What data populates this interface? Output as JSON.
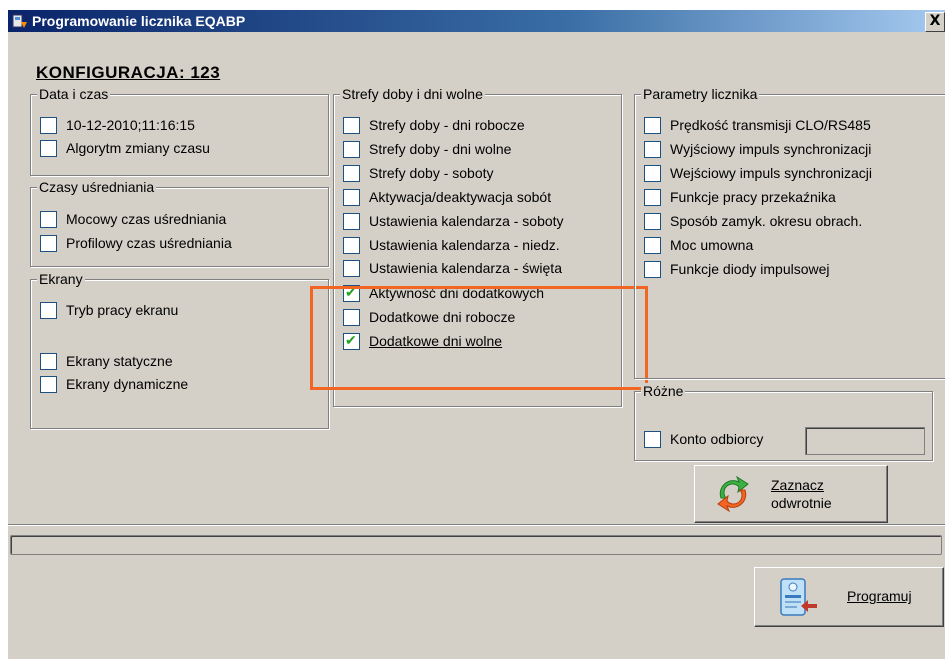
{
  "window": {
    "title": "Programowanie licznika EQABP",
    "close_label": "X"
  },
  "heading": "KONFIGURACJA:  123",
  "groups": {
    "data_czas": {
      "legend": "Data i czas",
      "items": [
        {
          "label": "10-12-2010;11:16:15",
          "checked": false
        },
        {
          "label": "Algorytm zmiany czasu",
          "checked": false
        }
      ]
    },
    "czasy": {
      "legend": "Czasy uśredniania",
      "items": [
        {
          "label": "Mocowy czas uśredniania",
          "checked": false
        },
        {
          "label": "Profilowy czas uśredniania",
          "checked": false
        }
      ]
    },
    "ekrany": {
      "legend": "Ekrany",
      "items": [
        {
          "label": "Tryb pracy ekranu",
          "checked": false
        },
        {
          "label": "Ekrany statyczne",
          "checked": false
        },
        {
          "label": "Ekrany dynamiczne",
          "checked": false
        }
      ]
    },
    "strefy": {
      "legend": "Strefy doby i dni wolne",
      "items": [
        {
          "label": "Strefy doby - dni robocze",
          "checked": false
        },
        {
          "label": "Strefy doby - dni wolne",
          "checked": false
        },
        {
          "label": "Strefy doby - soboty",
          "checked": false
        },
        {
          "label": "Aktywacja/deaktywacja sobót",
          "checked": false
        },
        {
          "label": "Ustawienia kalendarza - soboty",
          "checked": false
        },
        {
          "label": "Ustawienia kalendarza - niedz.",
          "checked": false
        },
        {
          "label": "Ustawienia kalendarza - święta",
          "checked": false
        },
        {
          "label": "Aktywność dni dodatkowych",
          "checked": true
        },
        {
          "label": "Dodatkowe dni robocze",
          "checked": false
        },
        {
          "label": "Dodatkowe dni wolne",
          "checked": true
        }
      ]
    },
    "parametry": {
      "legend": "Parametry licznika",
      "items": [
        {
          "label": "Prędkość transmisji CLO/RS485",
          "checked": false
        },
        {
          "label": "Wyjściowy impuls synchronizacji",
          "checked": false
        },
        {
          "label": "Wejściowy impuls synchronizacji",
          "checked": false
        },
        {
          "label": "Funkcje pracy przekaźnika",
          "checked": false
        },
        {
          "label": "Sposób zamyk. okresu obrach.",
          "checked": false
        },
        {
          "label": "Moc umowna",
          "checked": false
        },
        {
          "label": "Funkcje diody impulsowej",
          "checked": false
        }
      ]
    },
    "rozne": {
      "legend": "Różne",
      "items": [
        {
          "label": "Konto odbiorcy",
          "checked": false
        }
      ],
      "input_value": ""
    }
  },
  "buttons": {
    "invert_line1": "Zaznacz",
    "invert_line2": "odwrotnie",
    "program": "Programuj"
  },
  "progress": 0,
  "colors": {
    "highlight": "#f26522",
    "check": "#21a121",
    "face": "#d4d0c8",
    "title_start": "#0a246a"
  },
  "icons": {
    "app": "meter-app-icon",
    "invert": "refresh-arrows-icon",
    "program": "meter-program-icon",
    "close": "close-icon"
  }
}
